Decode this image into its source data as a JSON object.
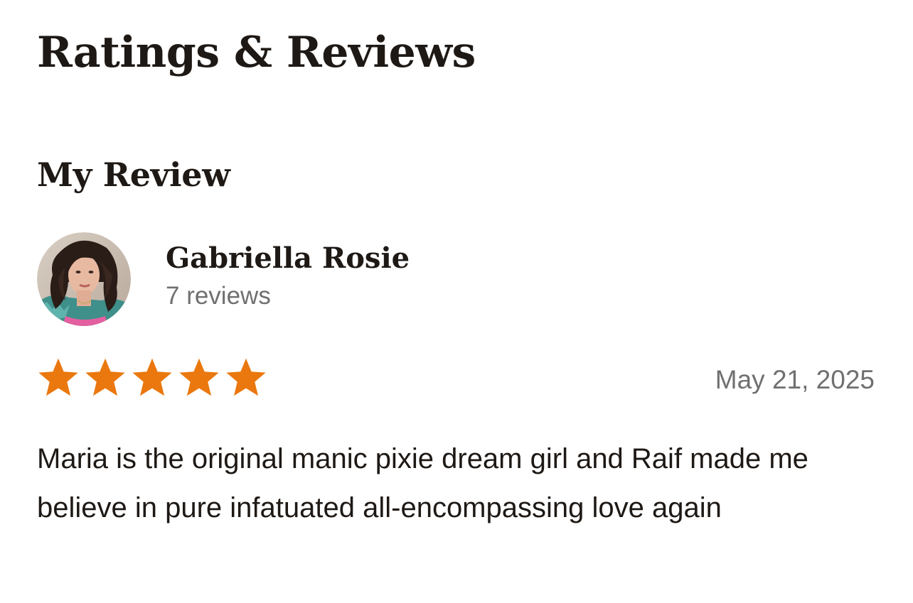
{
  "page": {
    "title": "Ratings & Reviews"
  },
  "my_review": {
    "section_title": "My Review",
    "reviewer": {
      "name": "Gabriella Rosie",
      "review_count": "7 reviews"
    },
    "rating": {
      "value": 5,
      "max": 5,
      "star_color": "#ea780e"
    },
    "date": "May 21, 2025",
    "text": "Maria is the original manic pixie dream girl and Raif made me believe in pure infatuated all-encompassing love again"
  }
}
